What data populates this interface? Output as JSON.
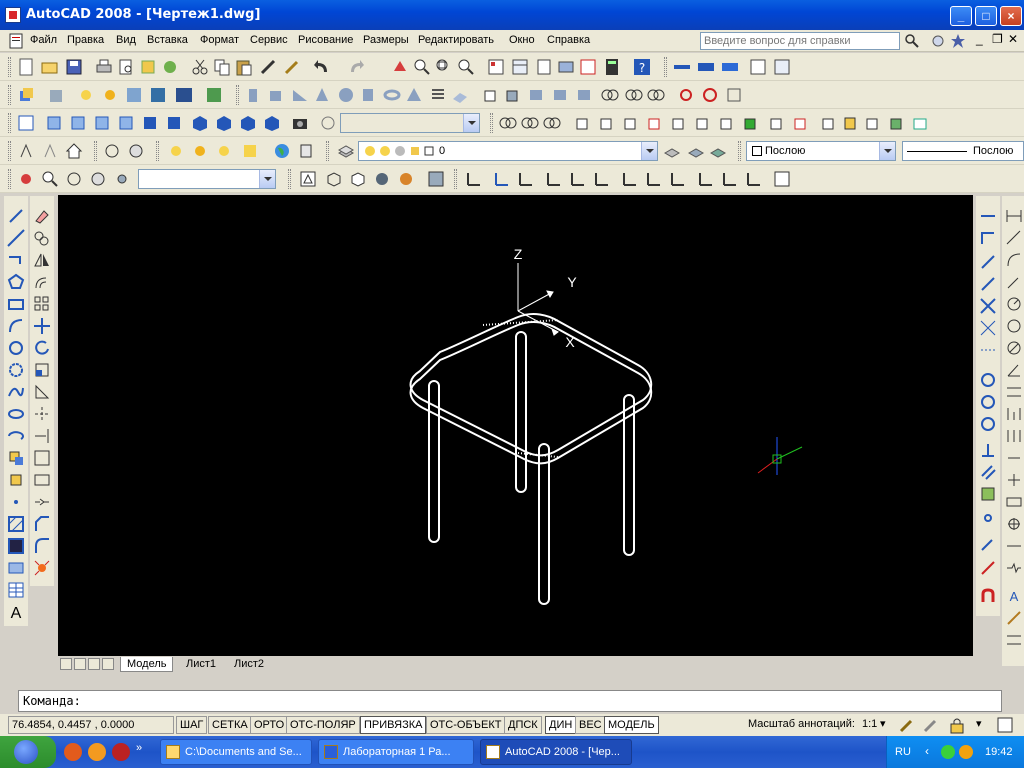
{
  "window": {
    "title": "AutoCAD 2008 - [Чертеж1.dwg]"
  },
  "menu": {
    "items": [
      "Файл",
      "Правка",
      "Вид",
      "Вставка",
      "Формат",
      "Сервис",
      "Рисование",
      "Размеры",
      "Редактировать",
      "Окно",
      "Справка"
    ],
    "help_placeholder": "Введите вопрос для справки"
  },
  "layers": {
    "current_layer": "0",
    "color": "Послою",
    "linetype": "Послою"
  },
  "viewport": {
    "axis_labels": {
      "z": "Z",
      "y": "Y",
      "x": "X"
    }
  },
  "tabs": [
    "Модель",
    "Лист1",
    "Лист2"
  ],
  "command": {
    "prompt": "Команда:"
  },
  "status": {
    "coords": "76.4854, 0.4457 , 0.0000",
    "buttons": [
      "ШАГ",
      "СЕТКА",
      "ОРТО",
      "ОТС-ПОЛЯР",
      "ПРИВЯЗКА",
      "ОТС-ОБЪЕКТ",
      "ДПСК",
      "ДИН",
      "ВЕС",
      "МОДЕЛЬ"
    ],
    "active_buttons": [
      "ПРИВЯЗКА",
      "ДИН",
      "МОДЕЛЬ"
    ],
    "annotation_scale_label": "Масштаб аннотаций:",
    "annotation_scale": "1:1"
  },
  "taskbar": {
    "tasks": [
      "C:\\Documents and Se...",
      "Лабораторная 1  Ра...",
      "AutoCAD 2008 - [Чер..."
    ],
    "language": "RU",
    "time": "19:42"
  },
  "colors": {
    "viewport_bg": "#000000",
    "title_bar": "#0046d5",
    "taskbar": "#245edb"
  }
}
